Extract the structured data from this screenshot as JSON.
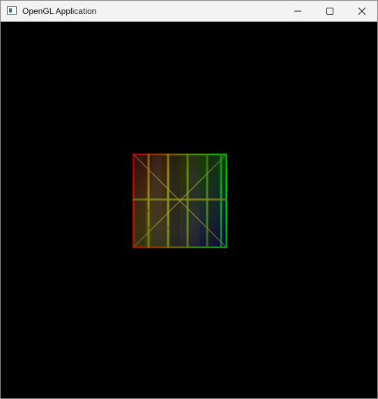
{
  "window": {
    "title": "OpenGL Application",
    "app_icon": "window-app-icon",
    "controls": {
      "minimize_icon": "minimize-icon",
      "maximize_icon": "maximize-icon",
      "close_icon": "close-icon"
    }
  },
  "scene": {
    "background_color": "#000000",
    "quad": {
      "texture": "wooden-crate",
      "corner_colors": {
        "top_left": "#ff0000",
        "top_right": "#00ff00",
        "bottom_right": "#0000ff",
        "bottom_left": "#ffff00"
      }
    }
  }
}
